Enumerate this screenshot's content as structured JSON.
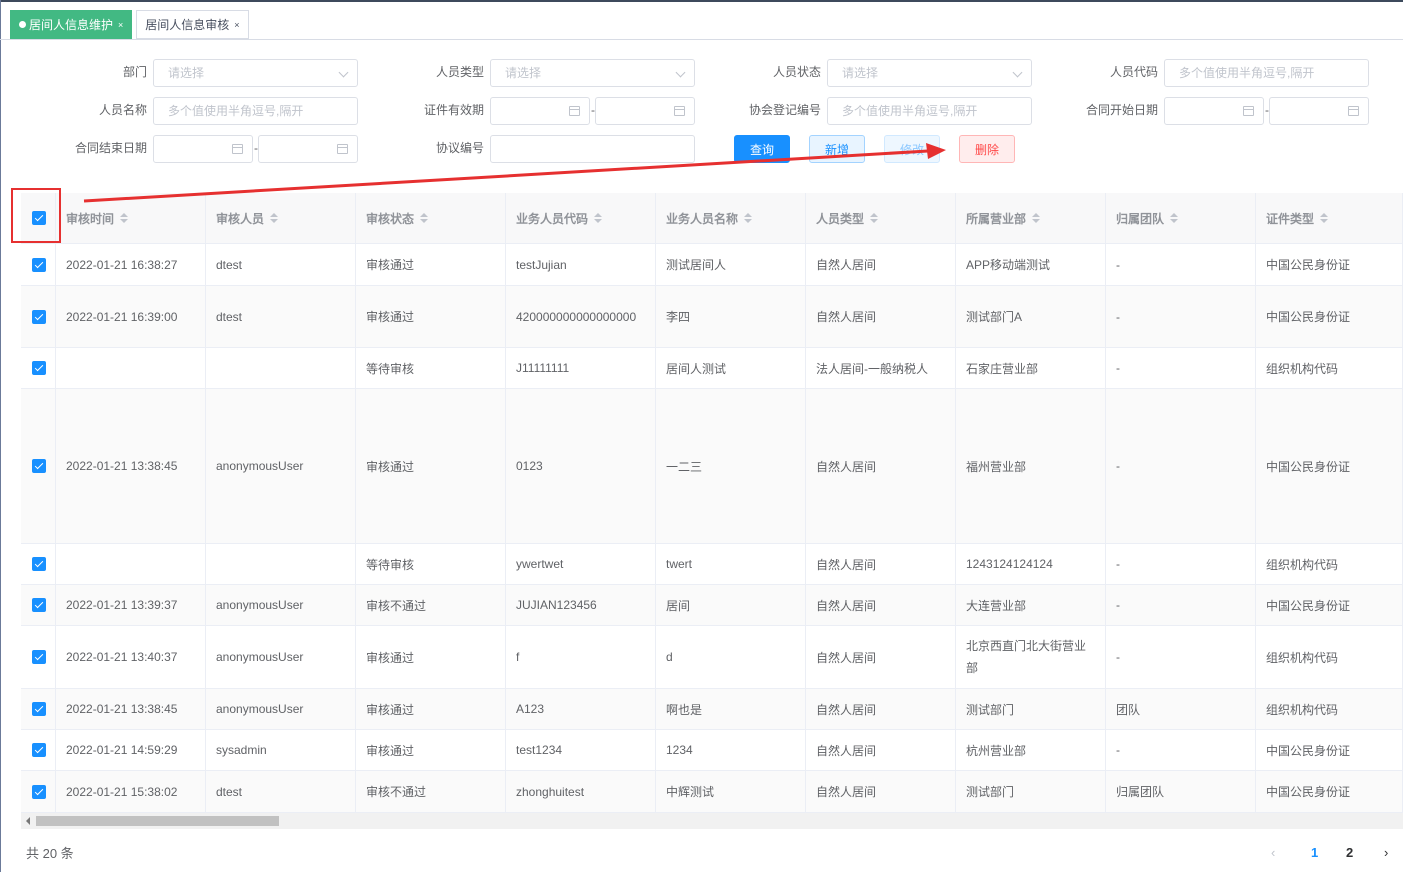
{
  "tabs": [
    {
      "label": "居间人信息维护",
      "active": true
    },
    {
      "label": "居间人信息审核",
      "active": false
    }
  ],
  "tab_close": "×",
  "form": {
    "dept_label": "部门",
    "dept_placeholder": "请选择",
    "person_type_label": "人员类型",
    "person_type_placeholder": "请选择",
    "person_status_label": "人员状态",
    "person_status_placeholder": "请选择",
    "person_code_label": "人员代码",
    "person_code_placeholder": "多个值使用半角逗号,隔开",
    "person_name_label": "人员名称",
    "person_name_placeholder": "多个值使用半角逗号,隔开",
    "cert_valid_label": "证件有效期",
    "assoc_no_label": "协会登记编号",
    "assoc_no_placeholder": "多个值使用半角逗号,隔开",
    "contract_start_label": "合同开始日期",
    "contract_end_label": "合同结束日期",
    "agreement_no_label": "协议编号",
    "range_sep": "-"
  },
  "buttons": {
    "query": "查询",
    "add": "新增",
    "edit": "修改",
    "delete": "删除"
  },
  "table": {
    "columns": [
      "审核时间",
      "审核人员",
      "审核状态",
      "业务人员代码",
      "业务人员名称",
      "人员类型",
      "所属营业部",
      "归属团队",
      "证件类型"
    ],
    "rows": [
      [
        "2022-01-21 16:38:27",
        "dtest",
        "审核通过",
        "testJujian",
        "测试居间人",
        "自然人居间",
        "APP移动端测试",
        "-",
        "中国公民身份证"
      ],
      [
        "2022-01-21 16:39:00",
        "dtest",
        "审核通过",
        "420000000000000000",
        "李四",
        "自然人居间",
        "测试部门A",
        "-",
        "中国公民身份证"
      ],
      [
        "",
        "",
        "等待审核",
        "J11111111",
        "居间人测试",
        "法人居间-一般纳税人",
        "石家庄营业部",
        "-",
        "组织机构代码"
      ],
      [
        "2022-01-21 13:38:45",
        "anonymousUser",
        "审核通过",
        "0123",
        "一二三",
        "自然人居间",
        "福州营业部",
        "-",
        "中国公民身份证"
      ],
      [
        "",
        "",
        "等待审核",
        "ywertwet",
        "twert",
        "自然人居间",
        "1243124124124",
        "-",
        "组织机构代码"
      ],
      [
        "2022-01-21 13:39:37",
        "anonymousUser",
        "审核不通过",
        "JUJIAN123456",
        "居间",
        "自然人居间",
        "大连营业部",
        "-",
        "中国公民身份证"
      ],
      [
        "2022-01-21 13:40:37",
        "anonymousUser",
        "审核通过",
        "f",
        "d",
        "自然人居间",
        "北京西直门北大街营业部",
        "-",
        "组织机构代码"
      ],
      [
        "2022-01-21 13:38:45",
        "anonymousUser",
        "审核通过",
        "A123",
        "啊也是",
        "自然人居间",
        "测试部门",
        "团队",
        "组织机构代码"
      ],
      [
        "2022-01-21 14:59:29",
        "sysadmin",
        "审核通过",
        "test1234",
        "1234",
        "自然人居间",
        "杭州营业部",
        "-",
        "中国公民身份证"
      ],
      [
        "2022-01-21 15:38:02",
        "dtest",
        "审核不通过",
        "zhonghuitest",
        "中辉测试",
        "自然人居间",
        "测试部门",
        "归属团队",
        "中国公民身份证"
      ]
    ]
  },
  "footer": {
    "total": "共 20 条",
    "pages": [
      "1",
      "2"
    ],
    "prev": "‹",
    "next": "›"
  },
  "colors": {
    "primary": "#1890ff",
    "tab_active": "#42b983",
    "annotation": "#e63030"
  }
}
